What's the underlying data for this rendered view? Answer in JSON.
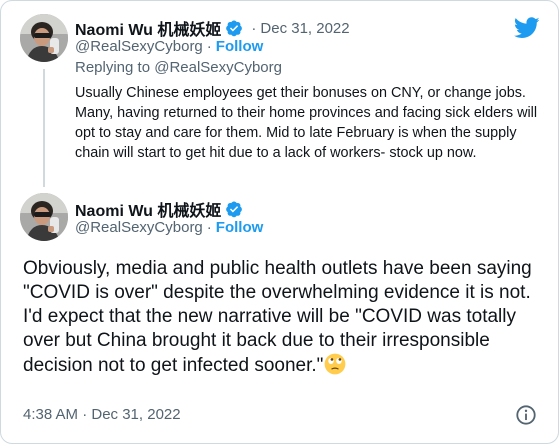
{
  "colors": {
    "accent": "#1d9bf0",
    "text": "#0f1419",
    "muted": "#536471",
    "border": "#cfd9de"
  },
  "icons": {
    "brand": "twitter-bird-icon",
    "verified": "verified-badge-icon",
    "info": "info-icon",
    "emoji": "face-with-rolling-eyes-emoji"
  },
  "quoted_tweet": {
    "display_name": "Naomi Wu 机械妖姬",
    "separator": "·",
    "date": "Dec 31, 2022",
    "handle": "@RealSexyCyborg",
    "follow_label": "Follow",
    "replying_to": "Replying to @RealSexyCyborg",
    "text": "Usually Chinese employees get their bonuses on CNY, or change jobs. Many, having returned to their home provinces and facing sick elders will opt to stay and care for them. Mid to late February is when the supply chain will start to get hit due to a lack of workers- stock up now."
  },
  "main_tweet": {
    "display_name": "Naomi Wu 机械妖姬",
    "handle": "@RealSexyCyborg",
    "separator": "·",
    "follow_label": "Follow",
    "text_line_1": "Obviously, media and public health outlets have been saying \"COVID is over\" despite the overwhelming evidence it is not.",
    "text_line_2": "I'd expect that the new narrative will be \"COVID was totally over but China brought it back due to their irresponsible decision not to get infected sooner.\"",
    "timestamp": "4:38 AM · Dec 31, 2022"
  }
}
